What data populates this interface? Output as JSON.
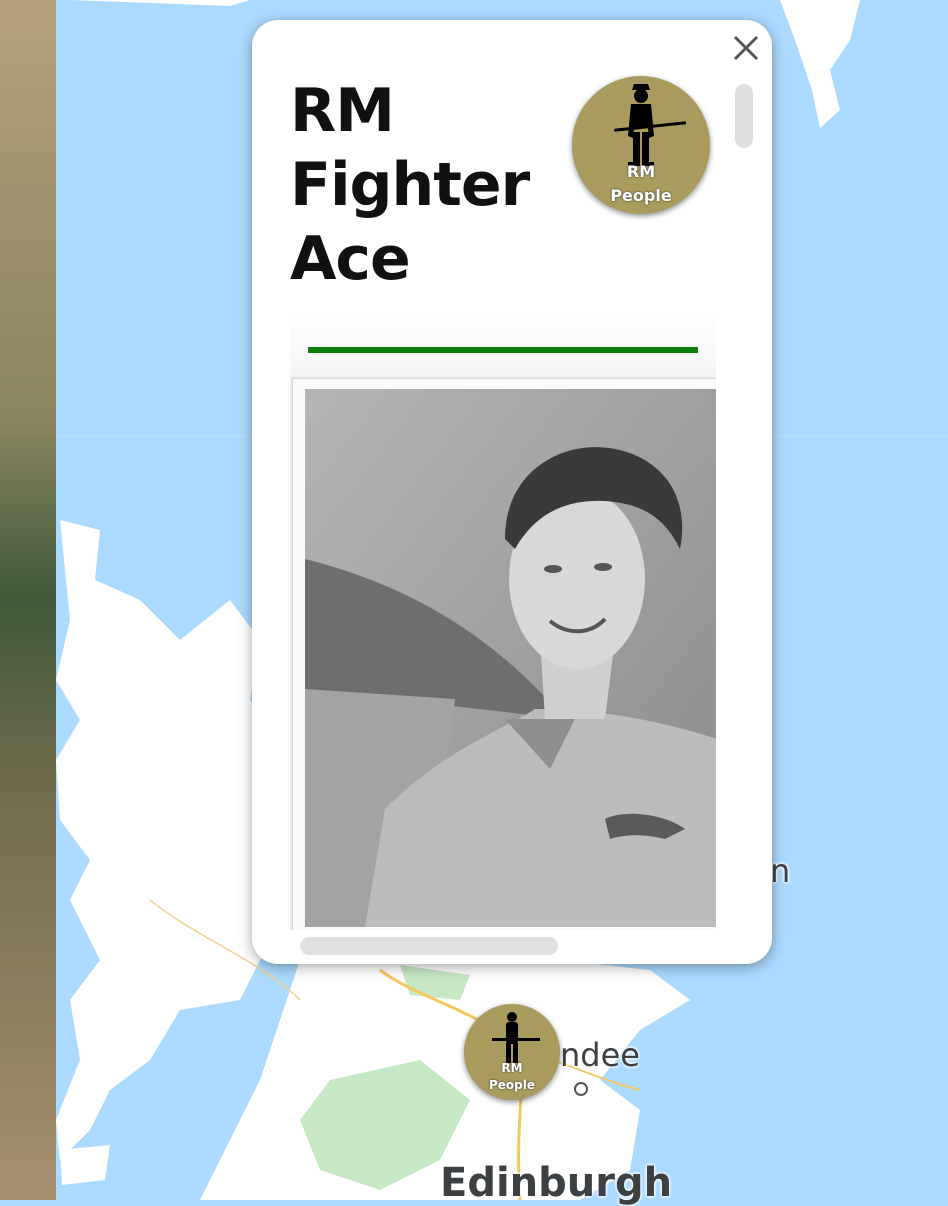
{
  "popup": {
    "title_lines": [
      "RM",
      "Fighter",
      "Ace"
    ],
    "close_label": "×",
    "badge": {
      "line1": "RM",
      "line2": "People",
      "color": "#a99a5e"
    },
    "divider_color": "#0a7f0a",
    "photo_alt": "Black and white portrait photo of a smiling man in uniform"
  },
  "marker": {
    "line1": "RM",
    "line2": "People"
  },
  "map": {
    "labels": {
      "dundee_partial": "ndee",
      "edinburgh_partial": "Edinburgh",
      "edge_partial": "n"
    },
    "colors": {
      "water": "#aadaff",
      "land": "#ffffff",
      "park": "#c6e8c4",
      "terrain": "#b8a482"
    }
  }
}
